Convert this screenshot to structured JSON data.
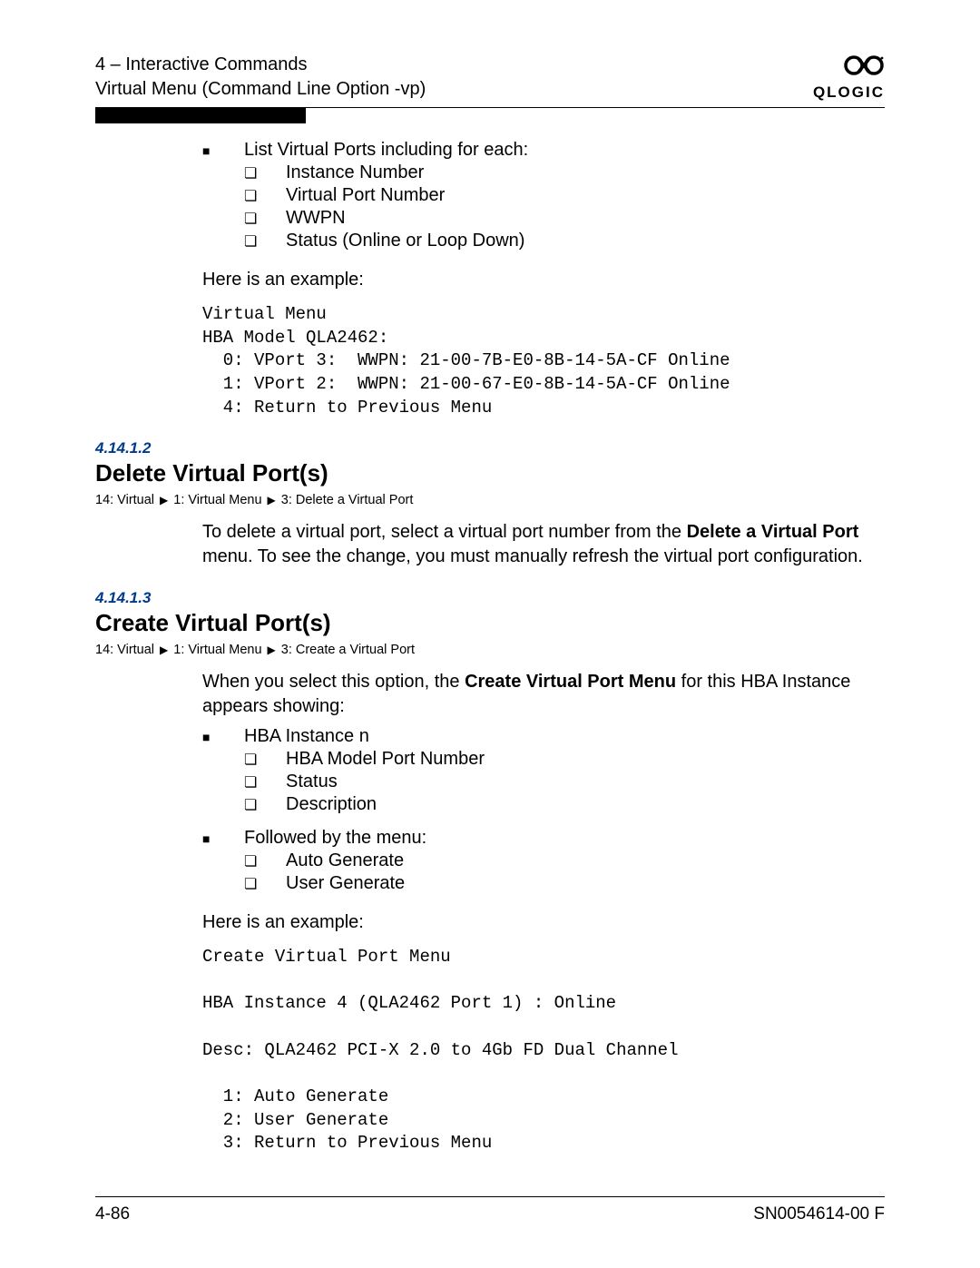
{
  "header": {
    "line1": "4 – Interactive Commands",
    "line2": "Virtual Menu (Command Line Option -vp)",
    "logo_text": "QLOGIC"
  },
  "intro": {
    "lead": "List Virtual Ports including for each:",
    "items": [
      "Instance Number",
      "Virtual Port Number",
      "WWPN",
      "Status (Online or Loop Down)"
    ],
    "example_lead": "Here is an example:",
    "code": "Virtual Menu\nHBA Model QLA2462:\n  0: VPort 3:  WWPN: 21-00-7B-E0-8B-14-5A-CF Online\n  1: VPort 2:  WWPN: 21-00-67-E0-8B-14-5A-CF Online\n  4: Return to Previous Menu"
  },
  "sec1": {
    "num": "4.14.1.2",
    "title": "Delete Virtual Port(s)",
    "bc": [
      "14: Virtual",
      "1: Virtual Menu",
      "3: Delete a Virtual Port"
    ],
    "para_pre": "To delete a virtual port, select a virtual port number from the ",
    "para_bold": "Delete a Virtual Port",
    "para_post": " menu. To see the change, you must manually refresh the virtual port configuration."
  },
  "sec2": {
    "num": "4.14.1.3",
    "title": "Create Virtual Port(s)",
    "bc": [
      "14: Virtual",
      "1: Virtual Menu",
      "3: Create a Virtual Port"
    ],
    "p1_pre": "When you select this option, the ",
    "p1_bold": "Create Virtual Port Menu",
    "p1_post": " for this HBA Instance appears showing:",
    "b1_lead": "HBA Instance n",
    "b1_items": [
      "HBA Model Port Number",
      "Status",
      "Description"
    ],
    "b2_lead": "Followed by the menu:",
    "b2_items": [
      "Auto Generate",
      "User Generate"
    ],
    "example_lead": "Here is an example:",
    "code": "Create Virtual Port Menu\n\nHBA Instance 4 (QLA2462 Port 1) : Online\n\nDesc: QLA2462 PCI-X 2.0 to 4Gb FD Dual Channel\n\n  1: Auto Generate\n  2: User Generate\n  3: Return to Previous Menu"
  },
  "footer": {
    "left": "4-86",
    "right": "SN0054614-00  F"
  }
}
